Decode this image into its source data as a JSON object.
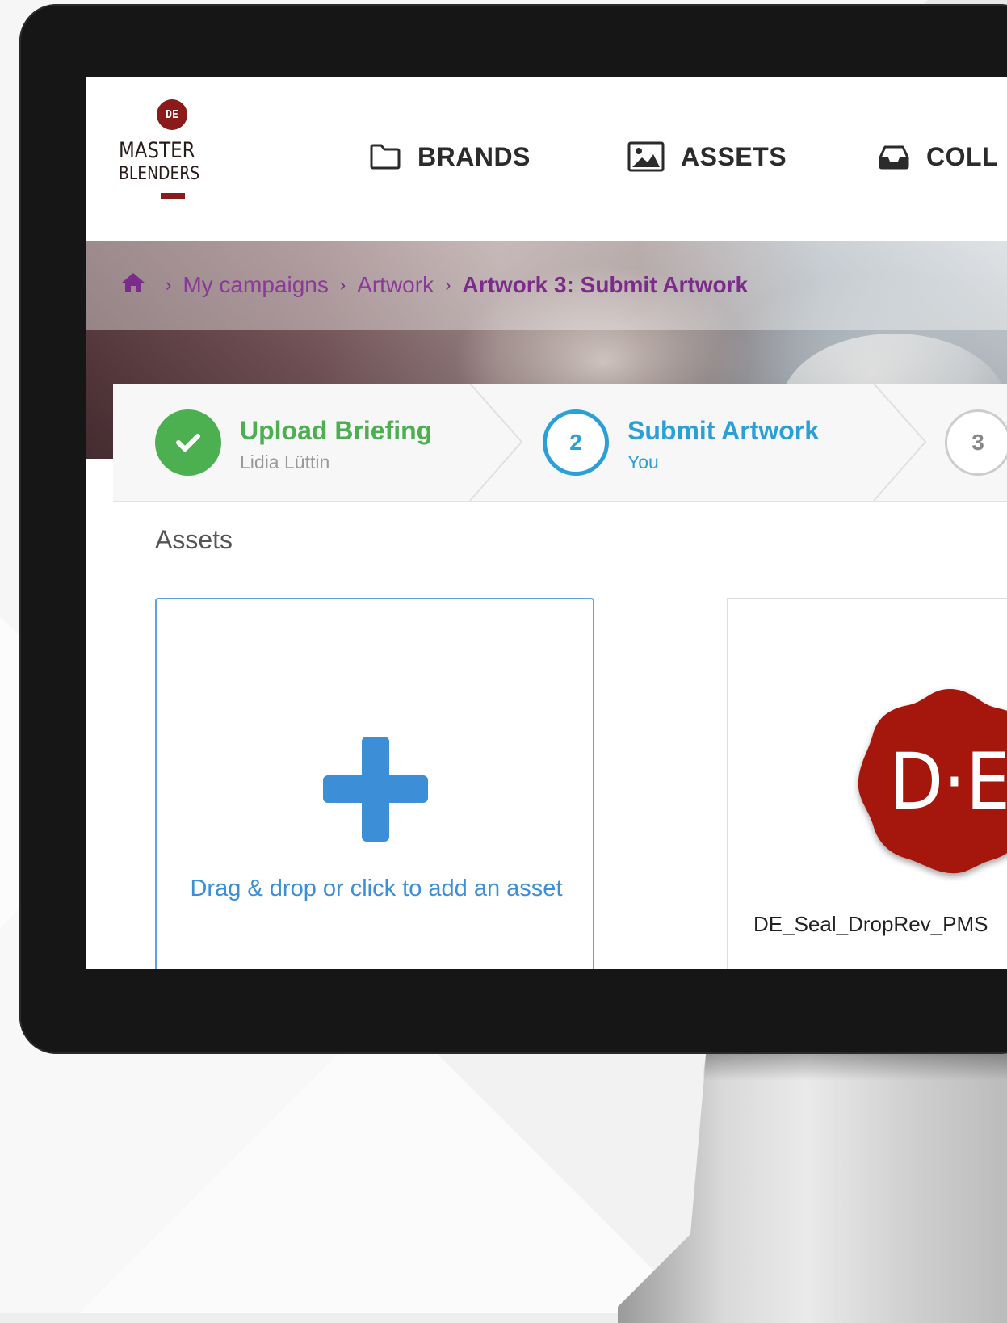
{
  "logo": {
    "seal": "DE",
    "line1": "MASTER",
    "line2": "BLENDERS"
  },
  "nav": {
    "items": [
      {
        "label": "BRANDS",
        "icon": "folder-icon"
      },
      {
        "label": "ASSETS",
        "icon": "image-icon"
      },
      {
        "label": "COLL",
        "icon": "inbox-icon"
      }
    ]
  },
  "breadcrumb": {
    "home_icon": "home-icon",
    "items": [
      "My campaigns",
      "Artwork"
    ],
    "current": "Artwork 3: Submit Artwork",
    "separator": "›"
  },
  "stepper": {
    "steps": [
      {
        "number": "1",
        "title": "Upload Briefing",
        "subtitle": "Lidia Lüttin",
        "status": "completed",
        "color": "#4caf50"
      },
      {
        "number": "2",
        "title": "Submit Artwork",
        "subtitle": "You",
        "status": "active",
        "color": "#2a9fd8"
      },
      {
        "number": "3",
        "title": "",
        "subtitle": "",
        "status": "pending",
        "color": "#cccccc"
      }
    ]
  },
  "assets": {
    "section_title": "Assets",
    "add_label": "Drag & drop or click to add an asset",
    "items": [
      {
        "name": "DE_Seal_DropRev_PMS",
        "thumb_text": "D·E",
        "thumb_color": "#a5150f"
      }
    ]
  }
}
